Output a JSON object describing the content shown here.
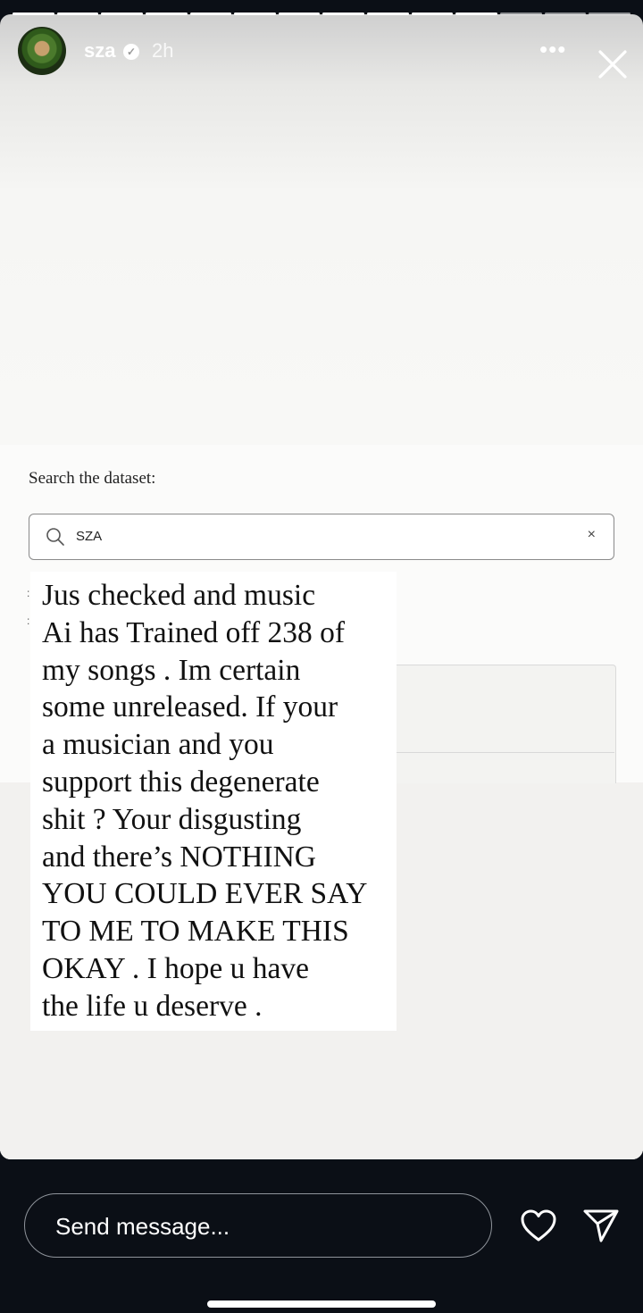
{
  "story_header": {
    "username": "sza",
    "verified": true,
    "timestamp": "2h",
    "more_icon": "more-horizontal-icon",
    "close_icon": "close-icon",
    "progress_segments_total": 14,
    "progress_segments_seen": 11
  },
  "screenshot_content": {
    "search_label": "Search the dataset:",
    "search_query": "SZA",
    "clear_symbol": "×",
    "result_ticks": [
      ":",
      ":"
    ]
  },
  "text_sticker": {
    "lines": [
      "Jus checked and music",
      "Ai has Trained off 238 of",
      "my songs . Im certain",
      "some unreleased. If your",
      "a musician and you",
      "support this degenerate",
      "shit ? Your disgusting",
      "and there’s NOTHING",
      "YOU COULD EVER SAY",
      "TO ME TO MAKE THIS",
      "OKAY . I hope u have",
      "the life u deserve ."
    ]
  },
  "reply_bar": {
    "placeholder": "Send message...",
    "like_icon": "heart-icon",
    "share_icon": "send-icon"
  },
  "colors": {
    "background": "#0b0f16",
    "story_text": "#ffffff",
    "sticker_background": "#ffffff",
    "sticker_text": "#111111"
  }
}
